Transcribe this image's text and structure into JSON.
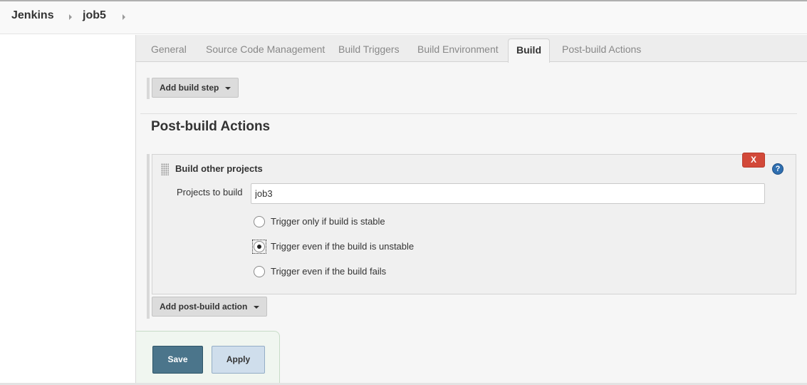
{
  "breadcrumb": {
    "items": [
      "Jenkins",
      "job5"
    ]
  },
  "tabs": [
    "General",
    "Source Code Management",
    "Build Triggers",
    "Build Environment",
    "Build",
    "Post-build Actions"
  ],
  "active_tab": "Build",
  "build": {
    "add_step_label": "Add build step"
  },
  "post_build": {
    "title": "Post-build Actions",
    "panel": {
      "title": "Build other projects",
      "delete_label": "X",
      "help_label": "?",
      "projects_label": "Projects to build",
      "projects_value": "job3",
      "options": [
        {
          "label": "Trigger only if build is stable",
          "checked": false
        },
        {
          "label": "Trigger even if the build is unstable",
          "checked": true
        },
        {
          "label": "Trigger even if the build fails",
          "checked": false
        }
      ]
    },
    "add_action_label": "Add post-build action"
  },
  "form": {
    "save_label": "Save",
    "apply_label": "Apply"
  }
}
